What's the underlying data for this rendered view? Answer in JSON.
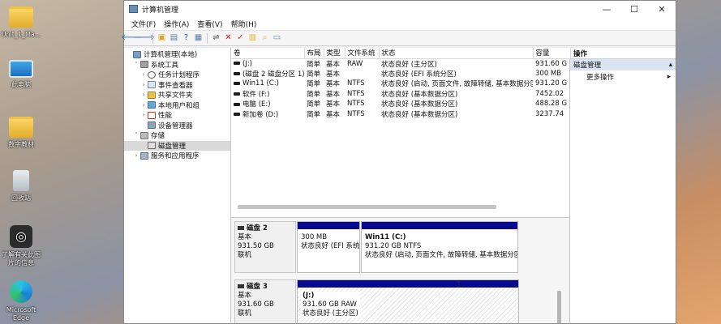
{
  "desktop": {
    "icons": [
      {
        "label": "Unit_1_Ma...",
        "icon": "folder-icon"
      },
      {
        "label": "此电脑",
        "icon": "monitor-icon"
      },
      {
        "label": "数字教材",
        "icon": "folder-icon"
      },
      {
        "label": "回收站",
        "icon": "recycle-bin-icon"
      },
      {
        "label": "了解有关此图片的信息",
        "icon": "camera-icon"
      },
      {
        "label": "Microsoft Edge",
        "icon": "edge-icon"
      }
    ]
  },
  "window": {
    "title": "计算机管理",
    "controls": {
      "minimize": "—",
      "maximize": "☐",
      "close": "✕"
    }
  },
  "menu": [
    "文件(F)",
    "操作(A)",
    "查看(V)",
    "帮助(H)"
  ],
  "tree": [
    {
      "label": "计算机管理(本地)",
      "level": 0,
      "twisty": "",
      "icon": "ic-comp"
    },
    {
      "label": "系统工具",
      "level": 1,
      "twisty": "˅",
      "icon": "ic-tool"
    },
    {
      "label": "任务计划程序",
      "level": 2,
      "twisty": "›",
      "icon": "ic-clock"
    },
    {
      "label": "事件查看器",
      "level": 2,
      "twisty": "›",
      "icon": "ic-event"
    },
    {
      "label": "共享文件夹",
      "level": 2,
      "twisty": "›",
      "icon": "ic-share"
    },
    {
      "label": "本地用户和组",
      "level": 2,
      "twisty": "›",
      "icon": "ic-users"
    },
    {
      "label": "性能",
      "level": 2,
      "twisty": "›",
      "icon": "ic-perf"
    },
    {
      "label": "设备管理器",
      "level": 2,
      "twisty": "",
      "icon": "ic-dev"
    },
    {
      "label": "存储",
      "level": 1,
      "twisty": "˅",
      "icon": "ic-stor"
    },
    {
      "label": "磁盘管理",
      "level": 2,
      "twisty": "",
      "icon": "ic-disk",
      "selected": true
    },
    {
      "label": "服务和应用程序",
      "level": 1,
      "twisty": "›",
      "icon": "ic-svc"
    }
  ],
  "volumes": {
    "columns": [
      "卷",
      "布局",
      "类型",
      "文件系统",
      "状态",
      "容量"
    ],
    "rows": [
      [
        "(J:)",
        "简单",
        "基本",
        "RAW",
        "状态良好 (主分区)",
        "931.60 G"
      ],
      [
        "(磁盘 2 磁盘分区 1)",
        "简单",
        "基本",
        "",
        "状态良好 (EFI 系统分区)",
        "300 MB"
      ],
      [
        "Win11 (C:)",
        "简单",
        "基本",
        "NTFS",
        "状态良好 (启动, 页面文件, 故障转储, 基本数据分区)",
        "931.20 G"
      ],
      [
        "软件 (F:)",
        "简单",
        "基本",
        "NTFS",
        "状态良好 (基本数据分区)",
        "7452.02"
      ],
      [
        "电脑 (E:)",
        "简单",
        "基本",
        "NTFS",
        "状态良好 (基本数据分区)",
        "488.28 G"
      ],
      [
        "新加卷 (D:)",
        "简单",
        "基本",
        "NTFS",
        "状态良好 (基本数据分区)",
        "3237.74"
      ]
    ]
  },
  "disks": [
    {
      "name": "磁盘 2",
      "type": "基本",
      "size": "931.50 GB",
      "status": "联机",
      "partitions": [
        {
          "title": "",
          "size": "300 MB",
          "desc": "状态良好 (EFI 系统分"
        },
        {
          "title": "Win11  (C:)",
          "size": "931.20 GB NTFS",
          "desc": "状态良好 (启动, 页面文件, 故障转储, 基本数据分区)"
        }
      ]
    },
    {
      "name": "磁盘 3",
      "type": "基本",
      "size": "931.60 GB",
      "status": "联机",
      "partitions": [
        {
          "title": "(J:)",
          "size": "931.60 GB RAW",
          "desc": "状态良好 (主分区)"
        }
      ]
    }
  ],
  "actions": {
    "header": "操作",
    "section": "磁盘管理",
    "items": [
      "更多操作"
    ]
  }
}
